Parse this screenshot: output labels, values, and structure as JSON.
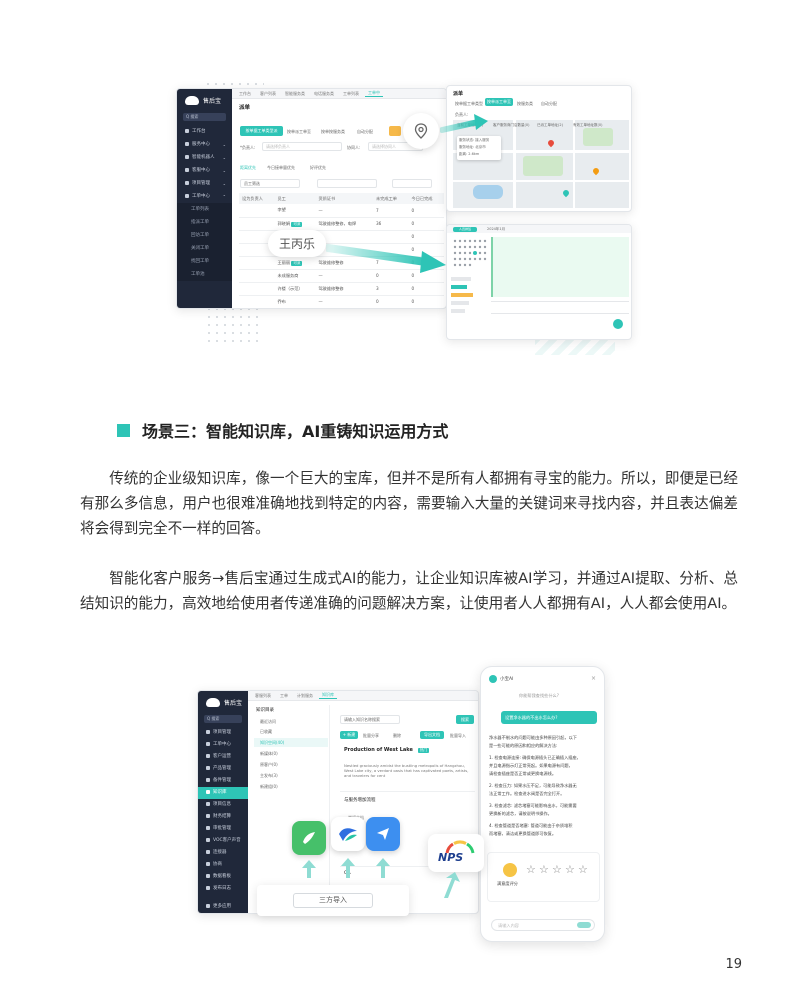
{
  "section": {
    "title": "场景三：智能知识库，AI重铸知识运用方式",
    "accent_color": "#2ec4b6"
  },
  "paragraphs": [
    "传统的企业级知识库，像一个巨大的宝库，但并不是所有人都拥有寻宝的能力。所以，即便是已经有那么多信息，用户也很难准确地找到特定的内容，需要输入大量的关键词来寻找内容，并且表达偏差将会得到完全不一样的回答。",
    "智能化客户服务→售后宝通过生成式AI的能力，让企业知识库被AI学习，并通过AI提取、分析、总结知识的能力，高效地给使用者传递准确的问题解决方案，让使用者人人都拥有AI，人人都会使用AI。"
  ],
  "page_number": "19",
  "top_shot": {
    "brand": "售后宝",
    "search": "Q 搜索",
    "sidebar": [
      "工作台",
      "服务中心",
      "智能机器人",
      "客服中心",
      "项目管理",
      "工单中心",
      "工单列表",
      "指派工单",
      "回访工单",
      "关闭工单",
      "找回工单",
      "工单池"
    ],
    "tabs": [
      "工作台",
      "客户列表",
      "智能服务类",
      "电话服务类",
      "工单列表",
      "工单中"
    ],
    "page_title": "派单",
    "filter_tabs": [
      "按单据工单类型派",
      "按单派工单至",
      "按单按服务类",
      "自动分配"
    ],
    "field_owner": "*负责人:",
    "field_owner_placeholder": "请选择负责人",
    "field_assist": "协同人:",
    "field_assist_placeholder": "请选择协同人",
    "chips": [
      "距离优先",
      "今日接单量优先",
      "好评优先"
    ],
    "select_label": "员工筛选",
    "columns": [
      "设为负责人",
      "员工",
      "资质证书",
      "未完成工单",
      "今日已完成"
    ],
    "rows": [
      [
        "",
        "李望",
        "—",
        "7",
        "0"
      ],
      [
        "",
        "郭晓娟",
        "驾驶维修整修，电焊",
        "36",
        "0"
      ],
      [
        "",
        "",
        "",
        "",
        "0"
      ],
      [
        "",
        "王丙乐",
        "",
        "",
        "0"
      ],
      [
        "",
        "王丽丽",
        "驾驶维修整修",
        "7",
        "0"
      ],
      [
        "",
        "未成服务商",
        "—",
        "0",
        "0"
      ],
      [
        "",
        "许楼（示范）",
        "驾驶维修整修",
        "3",
        "0"
      ],
      [
        "",
        "乔布",
        "—",
        "0",
        "0"
      ]
    ],
    "tag_label": "可派",
    "callout_name": "王丙乐",
    "map_panel_title": "派单",
    "map_panel_tabs": [
      "按单据工单类型",
      "按单派工单至",
      "按服务类",
      "自动分配"
    ],
    "map_owner": "负责人:",
    "map_legend": [
      "当前工单地址(1)",
      "客户服务商门店数量(0)",
      "已派工单地址(2)",
      "有效工单地址数(0)"
    ],
    "map_popup": [
      "服务状态: 接入服务",
      "服务地址: 北京市",
      "距离: 2.6km"
    ],
    "calendar_month": "2024年1月",
    "calendar_title": "人员排班"
  },
  "bottom_shot": {
    "brand": "售后宝",
    "search": "Q 搜索",
    "sidebar": [
      "项目管理",
      "工单中心",
      "客户运营",
      "产品管理",
      "备件管理",
      "知识库",
      "项目信息",
      "财务结算",
      "审批管理",
      "VOC客户声音",
      "连接器",
      "协商",
      "数据看板",
      "发布日志",
      "更多应用"
    ],
    "tabs": [
      "客服列表",
      "工单",
      "计划服务",
      "知识库"
    ],
    "tree_title": "知识目录",
    "tree": [
      "最近访问",
      "已收藏",
      "知识空间(40)",
      "新媒体(0)",
      "原客户(0)",
      "主发布(3)",
      "新建组(0)"
    ],
    "search_placeholder": "请输入知识名称搜索",
    "search_button": "搜索",
    "toolbar": [
      "+ 新建",
      "批量分享",
      "删除",
      "导出文档",
      "批量导入"
    ],
    "article_title": "Production of West Lake",
    "article_tag": "热门",
    "article_excerpt": "Nestled graciously amidst the bustling metropolis of Hangzhou, West Lake city, a verdant oasis that has captivated poets, artists, and travelers for cent",
    "article2_title": "与服务增加流程",
    "article2_tag": "常规文档",
    "article3_title": "QA",
    "import_button": "三方导入",
    "nps_label": "NPS",
    "chat_title": "小宝AI",
    "chat_greeting": "你能帮我查找些什么?",
    "chat_question": "设置净水器的不出水怎么办?",
    "chat_answer": [
      "净水器不制水的问题可能由多种原因引起，以下",
      "是一些可能的原因和相应的解决方法:",
      "1. 检查电源连接: 确保电源插头已正确插入插座，",
      "   并且电源指示灯正常亮起。如果电源有问题，",
      "   请检查插座是否正常或更换电源线。",
      "2. 检查压力: 如果水压不足，可能导致净水器无",
      "   法正常工作。检查进水阀是否完全打开。",
      "3. 检查滤芯: 滤芯堵塞可能影响出水，可能需要",
      "   更换新的滤芯，请按说明书操作。",
      "4. 检查管道是否堵塞: 管道可能由于杂质堆积",
      "   而堵塞，清洁或更换管道即可恢复。"
    ],
    "chat_feedback": "满意度评分",
    "chat_input_placeholder": "请输入内容"
  }
}
